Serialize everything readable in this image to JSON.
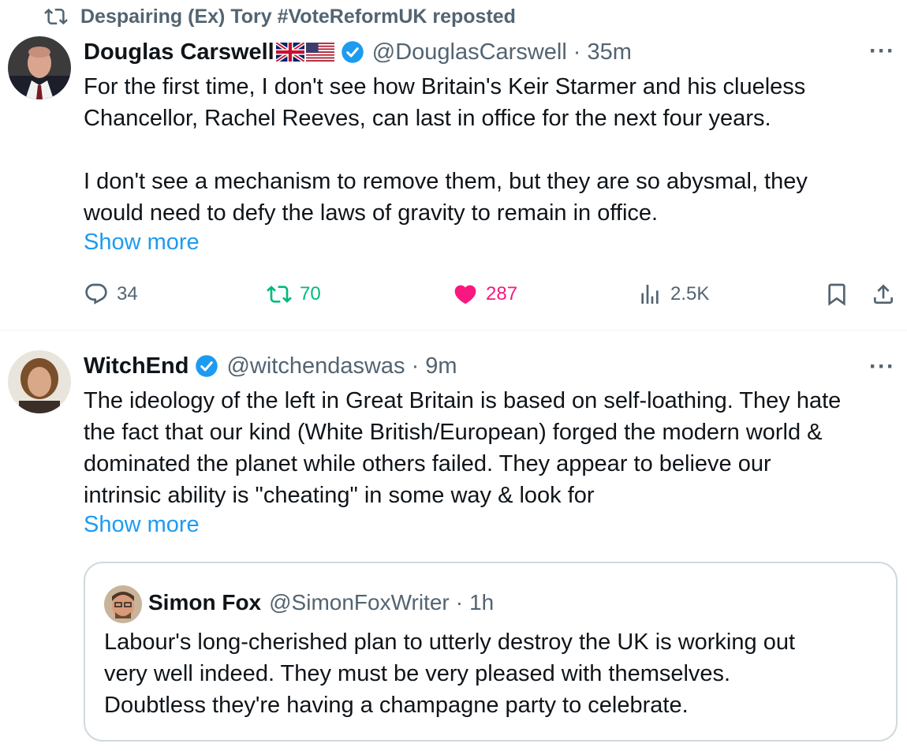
{
  "repost_banner": {
    "text": "Despairing (Ex) Tory #VoteReformUK reposted",
    "icon": "repost-icon"
  },
  "tweet1": {
    "display_name": "Douglas Carswell",
    "flags": [
      "uk-flag-icon",
      "us-flag-icon"
    ],
    "verified_icon": "verified-badge-icon",
    "handle": "@DouglasCarswell",
    "dot": "·",
    "time": "35m",
    "more": "···",
    "text_lines": [
      "For the first time, I don't see how Britain's Keir Starmer and his clueless",
      "Chancellor, Rachel Reeves, can last in office for the next four years.",
      "",
      "I don't see a mechanism to remove them, but they are so abysmal, they",
      "would need to defy the laws of gravity to remain in office."
    ],
    "show_more": "Show more",
    "actions": {
      "replies": "34",
      "reposts": "70",
      "likes": "287",
      "views": "2.5K"
    },
    "colors": {
      "repost": "#00ba7c",
      "like": "#f91880"
    }
  },
  "tweet2": {
    "display_name": "WitchEnd",
    "verified_icon": "verified-badge-icon",
    "handle": "@witchendaswas",
    "dot": "·",
    "time": "9m",
    "more": "···",
    "text_lines": [
      "The ideology of the left in Great Britain is based on self-loathing. They hate",
      "the fact that our kind (White British/European) forged the modern world &",
      "dominated the planet while others failed. They appear to believe our",
      "intrinsic ability is \"cheating\" in some way & look for"
    ],
    "show_more": "Show more"
  },
  "quote": {
    "display_name": "Simon Fox",
    "handle": "@SimonFoxWriter",
    "dot": "·",
    "time": "1h",
    "text_lines": [
      "Labour's long-cherished plan to utterly destroy the UK is working out",
      "very well indeed. They must be very pleased with themselves.",
      "Doubtless they're having a champagne party to celebrate."
    ]
  },
  "colors": {
    "link": "#1d9bf0",
    "secondary_text": "#536471",
    "primary_text": "#0f1419",
    "border": "#cfd9de"
  }
}
